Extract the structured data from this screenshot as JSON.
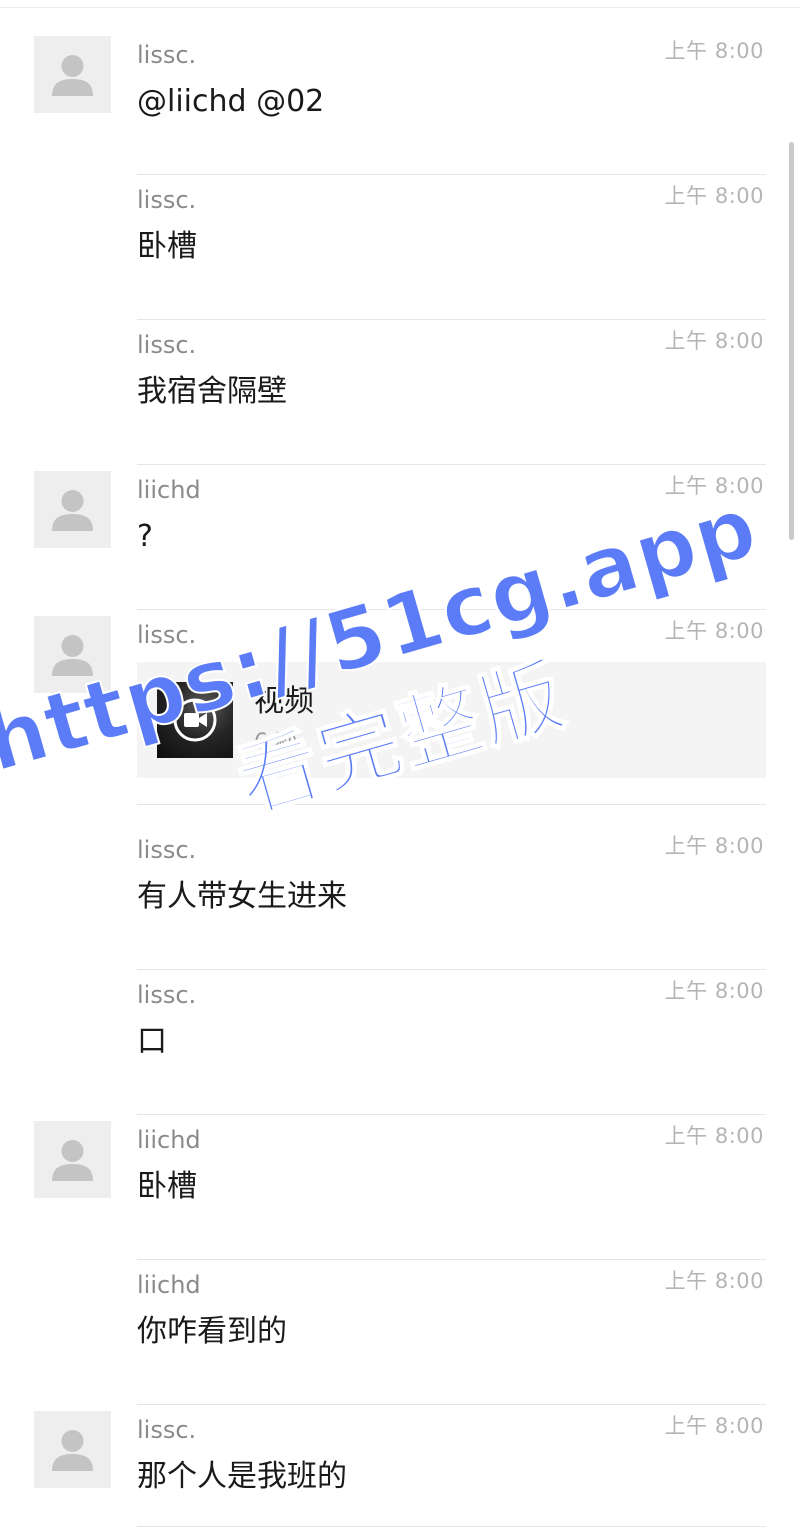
{
  "messages": [
    {
      "sender": "lissc.",
      "time": "上午 8:00",
      "text": "@liichd @02"
    },
    {
      "sender": "lissc.",
      "time": "上午 8:00",
      "text": "卧槽"
    },
    {
      "sender": "lissc.",
      "time": "上午 8:00",
      "text": "我宿舍隔壁"
    },
    {
      "sender": "liichd",
      "time": "上午 8:00",
      "text": "?"
    },
    {
      "sender": "lissc.",
      "time": "上午 8:00",
      "video": {
        "title": "视频",
        "duration": "6 秒"
      }
    },
    {
      "sender": "lissc.",
      "time": "上午 8:00",
      "text": "有人带女生进来"
    },
    {
      "sender": "lissc.",
      "time": "上午 8:00",
      "text": "口"
    },
    {
      "sender": "liichd",
      "time": "上午 8:00",
      "text": "卧槽"
    },
    {
      "sender": "liichd",
      "time": "上午 8:00",
      "text": "你咋看到的"
    },
    {
      "sender": "lissc.",
      "time": "上午 8:00",
      "text": "那个人是我班的"
    }
  ],
  "watermark": {
    "line1": "https://51cg.app",
    "line2": "看完整版"
  },
  "colors": {
    "watermark": "#5b7cf6",
    "sender": "#8a8a8a",
    "time": "#b5b5b5"
  }
}
